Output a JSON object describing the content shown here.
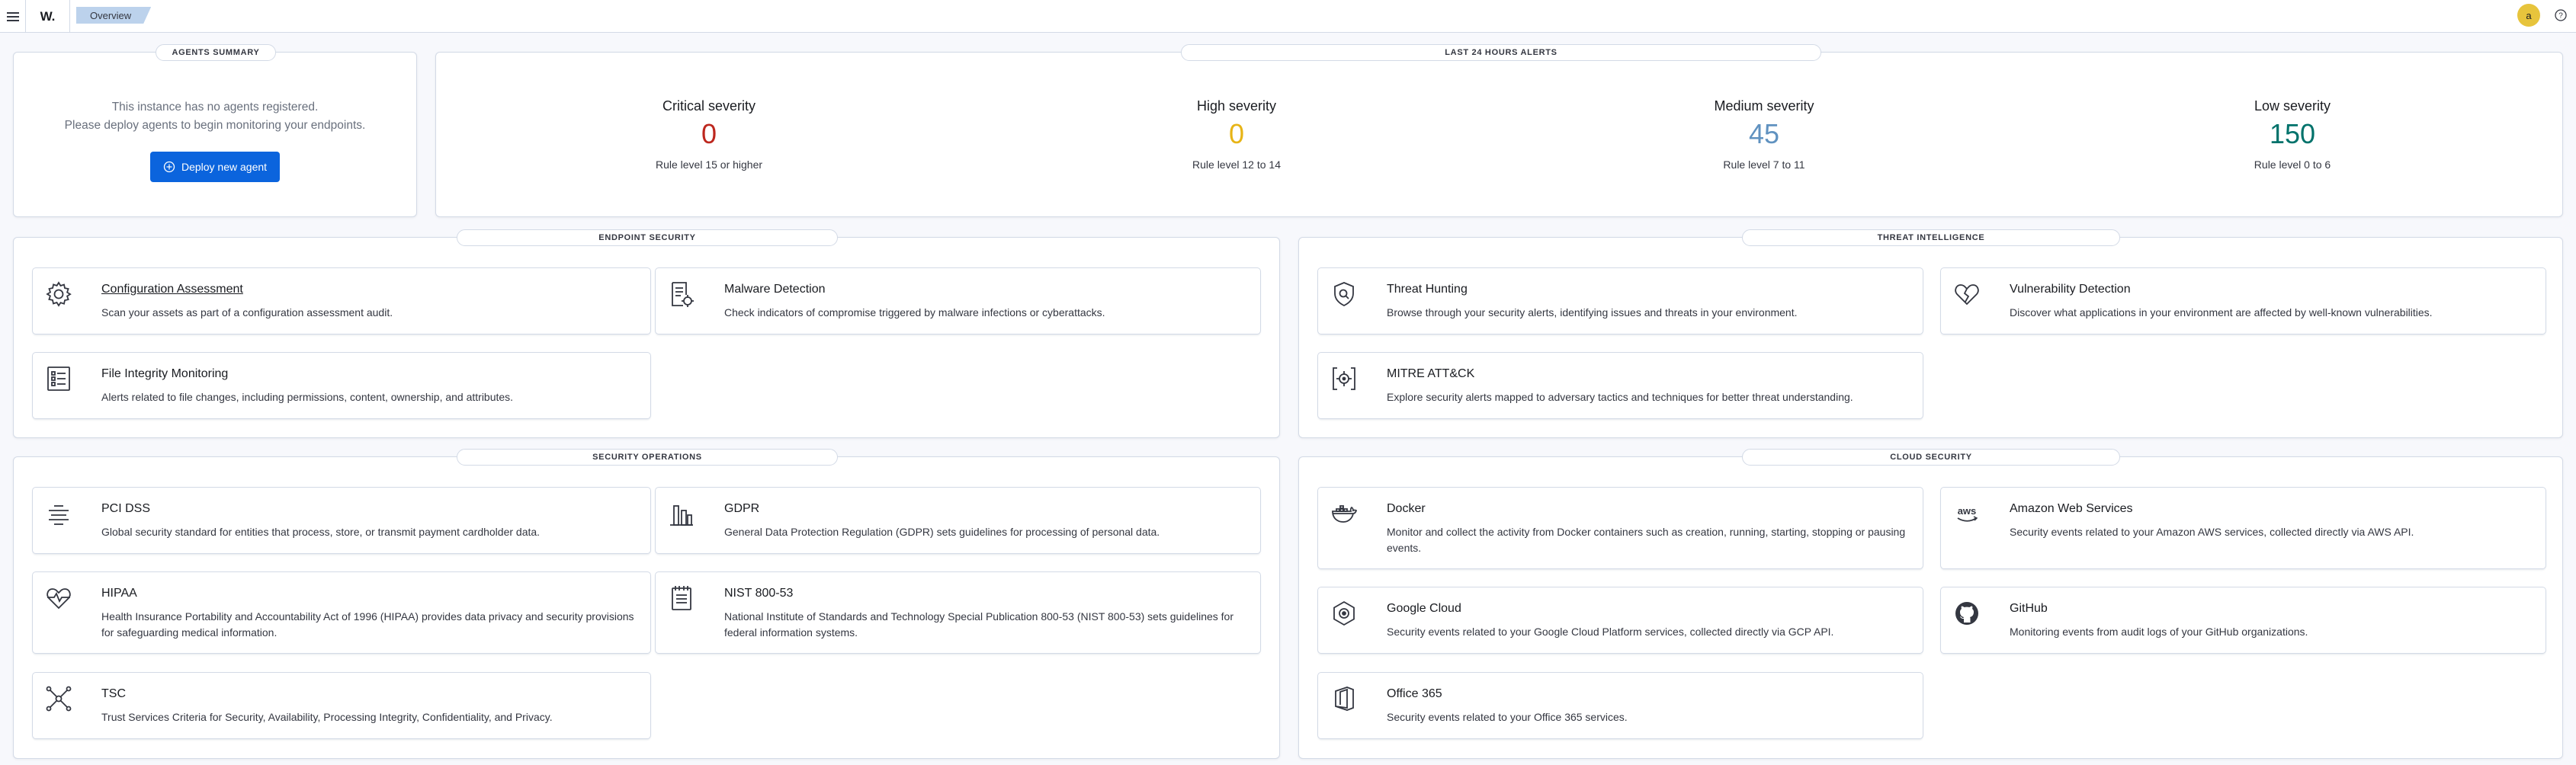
{
  "header": {
    "logo": "W.",
    "breadcrumb": "Overview",
    "avatar_initial": "a"
  },
  "agents_summary": {
    "title": "AGENTS SUMMARY",
    "message_line1": "This instance has no agents registered.",
    "message_line2": "Please deploy agents to begin monitoring your endpoints.",
    "deploy_label": "Deploy new agent"
  },
  "alerts": {
    "title": "LAST 24 HOURS ALERTS",
    "items": [
      {
        "label": "Critical severity",
        "value": "0",
        "sub": "Rule level 15 or higher",
        "color": "#bd271e"
      },
      {
        "label": "High severity",
        "value": "0",
        "sub": "Rule level 12 to 14",
        "color": "#e7b416"
      },
      {
        "label": "Medium severity",
        "value": "45",
        "sub": "Rule level 7 to 11",
        "color": "#6092c0"
      },
      {
        "label": "Low severity",
        "value": "150",
        "sub": "Rule level 0 to 6",
        "color": "#00726b"
      }
    ]
  },
  "endpoint_security": {
    "title": "ENDPOINT SECURITY",
    "cards": [
      {
        "title": "Configuration Assessment",
        "desc": "Scan your assets as part of a configuration assessment audit.",
        "icon": "gear-icon"
      },
      {
        "title": "Malware Detection",
        "desc": "Check indicators of compromise triggered by malware infections or cyberattacks.",
        "icon": "malware-document-icon"
      },
      {
        "title": "File Integrity Monitoring",
        "desc": "Alerts related to file changes, including permissions, content, ownership, and attributes.",
        "icon": "list-document-icon"
      }
    ]
  },
  "threat_intelligence": {
    "title": "THREAT INTELLIGENCE",
    "cards": [
      {
        "title": "Threat Hunting",
        "desc": "Browse through your security alerts, identifying issues and threats in your environment.",
        "icon": "shield-search-icon"
      },
      {
        "title": "Vulnerability Detection",
        "desc": "Discover what applications in your environment are affected by well-known vulnerabilities.",
        "icon": "broken-heart-icon"
      },
      {
        "title": "MITRE ATT&CK",
        "desc": "Explore security alerts mapped to adversary tactics and techniques for better threat understanding.",
        "icon": "brackets-target-icon"
      }
    ]
  },
  "security_operations": {
    "title": "SECURITY OPERATIONS",
    "cards": [
      {
        "title": "PCI DSS",
        "desc": "Global security standard for entities that process, store, or transmit payment cardholder data.",
        "icon": "pci-lines-icon"
      },
      {
        "title": "GDPR",
        "desc": "General Data Protection Regulation (GDPR) sets guidelines for processing of personal data.",
        "icon": "building-icon"
      },
      {
        "title": "HIPAA",
        "desc": "Health Insurance Portability and Accountability Act of 1996 (HIPAA) provides data privacy and security provisions for safeguarding medical information.",
        "icon": "heart-pulse-icon"
      },
      {
        "title": "NIST 800-53",
        "desc": "National Institute of Standards and Technology Special Publication 800-53 (NIST 800-53) sets guidelines for federal information systems.",
        "icon": "notebook-icon"
      },
      {
        "title": "TSC",
        "desc": "Trust Services Criteria for Security, Availability, Processing Integrity, Confidentiality, and Privacy.",
        "icon": "network-nodes-icon"
      }
    ]
  },
  "cloud_security": {
    "title": "CLOUD SECURITY",
    "cards": [
      {
        "title": "Docker",
        "desc": "Monitor and collect the activity from Docker containers such as creation, running, starting, stopping or pausing events.",
        "icon": "docker-icon"
      },
      {
        "title": "Amazon Web Services",
        "desc": "Security events related to your Amazon AWS services, collected directly via AWS API.",
        "icon": "aws-icon"
      },
      {
        "title": "Google Cloud",
        "desc": "Security events related to your Google Cloud Platform services, collected directly via GCP API.",
        "icon": "google-cloud-icon"
      },
      {
        "title": "GitHub",
        "desc": "Monitoring events from audit logs of your GitHub organizations.",
        "icon": "github-icon"
      },
      {
        "title": "Office 365",
        "desc": "Security events related to your Office 365 services.",
        "icon": "office-icon"
      }
    ]
  }
}
